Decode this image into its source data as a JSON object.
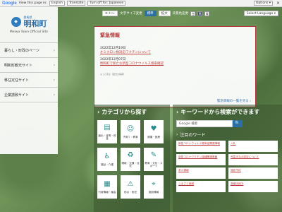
{
  "translate_bar": {
    "logo": "Google",
    "view_text": "View this page in:",
    "language": "English",
    "translate": "Translate",
    "turn_off": "Turn off for: Japanese",
    "options": "Options ▾",
    "close": "×"
  },
  "toolbar": {
    "menu": "≡ ﾒﾆｭｰ",
    "font_size_label": "文字サイズ変更",
    "standard": "標準",
    "large": "拡大",
    "bg_label": "背景色変更",
    "bg_white": "白",
    "bg_black": "黒",
    "bg_blue": "青",
    "select_language": "Select Language ▾"
  },
  "logo": {
    "prefecture": "群馬県",
    "name": "明和町",
    "english": "Meiwa Town Official Site",
    "mark": "◆"
  },
  "sidebar": {
    "items": [
      {
        "label": "暮らし・町政のページ",
        "arrow": "›"
      },
      {
        "label": "明和町観光サイト",
        "arrow": "›"
      },
      {
        "label": "移住定住サイト",
        "arrow": "›"
      },
      {
        "label": "企業誘致サイト",
        "arrow": "›"
      }
    ]
  },
  "news": {
    "title": "緊急情報",
    "items": [
      {
        "date": "2022年12月19日",
        "link": "オミクロン株対応ワクチンについて"
      },
      {
        "date": "2022年12月07日",
        "link": "明和町で新たな新型コロナウイルス感染確認"
      }
    ],
    "extra": "もっと見る（過去の情報）",
    "more": "緊急情報の一覧を見る ›"
  },
  "categories": {
    "title": "カテゴリから探す",
    "tiles": [
      {
        "icon": "document-icon",
        "glyph": "▤",
        "label": "届出・証明・税金"
      },
      {
        "icon": "baby-icon",
        "glyph": "☺",
        "label": "子育て・教育"
      },
      {
        "icon": "heart-icon",
        "glyph": "♥",
        "label": "健康・医療"
      },
      {
        "icon": "welfare-icon",
        "glyph": "♿",
        "label": "福祉・介護"
      },
      {
        "icon": "environment-icon",
        "glyph": "♻",
        "label": "環境・交通・住宅"
      },
      {
        "icon": "culture-icon",
        "glyph": "✎",
        "label": "教育・文化・スポーツ"
      },
      {
        "icon": "building-icon",
        "glyph": "▦",
        "label": "行政情報・議会"
      },
      {
        "icon": "safety-icon",
        "glyph": "⚠",
        "label": "防災・防犯"
      },
      {
        "icon": "map-icon",
        "glyph": "⌖",
        "label": "施設情報"
      }
    ]
  },
  "keyword": {
    "title": "キーワードから検索ができます",
    "placeholder": "Google 検索",
    "search_glyph": "🔍",
    "hot_label": "注目のワード",
    "words": [
      "新型コロナウイルス感染症関連情報",
      "入札",
      "新型コロナワクチン接種関連情報",
      "児童手当の認定について",
      "求人情報",
      "施設予約",
      "ふるさと納税",
      "各種手続き"
    ]
  }
}
